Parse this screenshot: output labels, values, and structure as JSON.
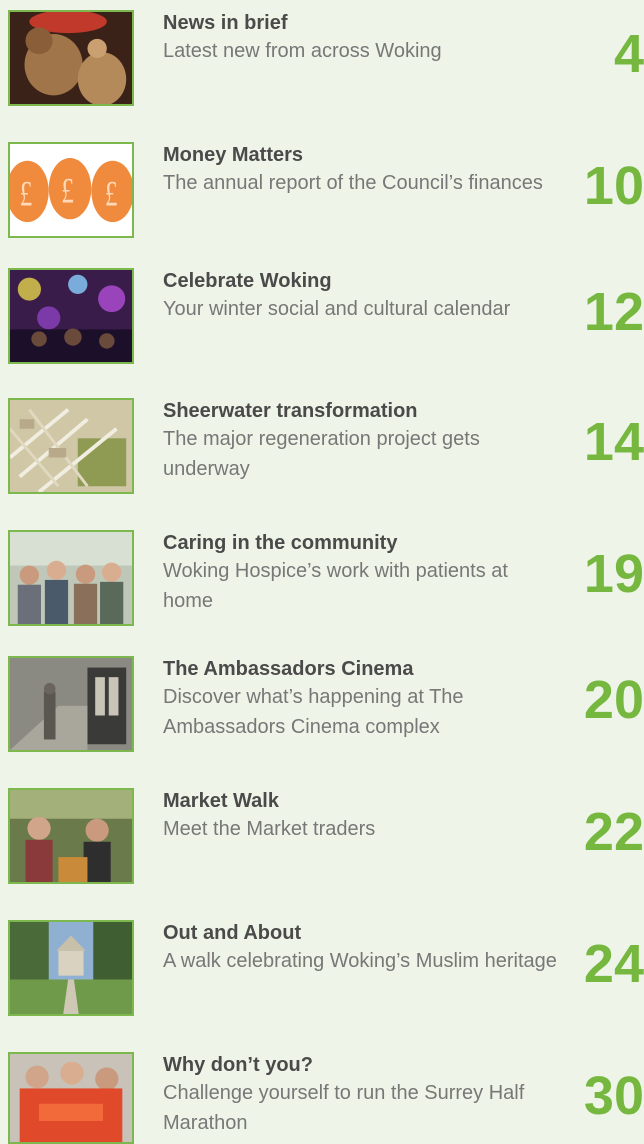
{
  "items": [
    {
      "title": "News in brief",
      "desc": "Latest new from across Woking",
      "page": "4",
      "image": "teddy-bear-photo"
    },
    {
      "title": "Money Matters",
      "desc": "The annual report of the Council’s finances",
      "page": "10",
      "image": "pound-coins-graphic"
    },
    {
      "title": "Celebrate Woking",
      "desc": "Your winter social and cultural calendar",
      "page": "12",
      "image": "concert-crowd-photo"
    },
    {
      "title": "Sheerwater transformation",
      "desc": "The major regeneration project gets underway",
      "page": "14",
      "image": "aerial-plan-photo"
    },
    {
      "title": "Caring in the community",
      "desc": "Woking Hospice’s work with patients at home",
      "page": "19",
      "image": "group-people-photo"
    },
    {
      "title": "The Ambassadors Cinema",
      "desc": "Discover what’s happening at The Ambassadors Cinema complex",
      "page": "20",
      "image": "cinema-corridor-photo"
    },
    {
      "title": "Market Walk",
      "desc": "Meet the Market traders",
      "page": "22",
      "image": "market-traders-photo"
    },
    {
      "title": "Out and About",
      "desc": "A walk celebrating Woking’s Muslim heritage",
      "page": "24",
      "image": "mosque-garden-photo"
    },
    {
      "title": "Why don’t you?",
      "desc": "Challenge yourself to run the Surrey Half Marathon",
      "page": "30",
      "image": "runners-photo"
    }
  ],
  "colors": {
    "accent": "#76b73f",
    "background": "#eef5e8",
    "title": "#4a4a4a",
    "text": "#777777"
  }
}
